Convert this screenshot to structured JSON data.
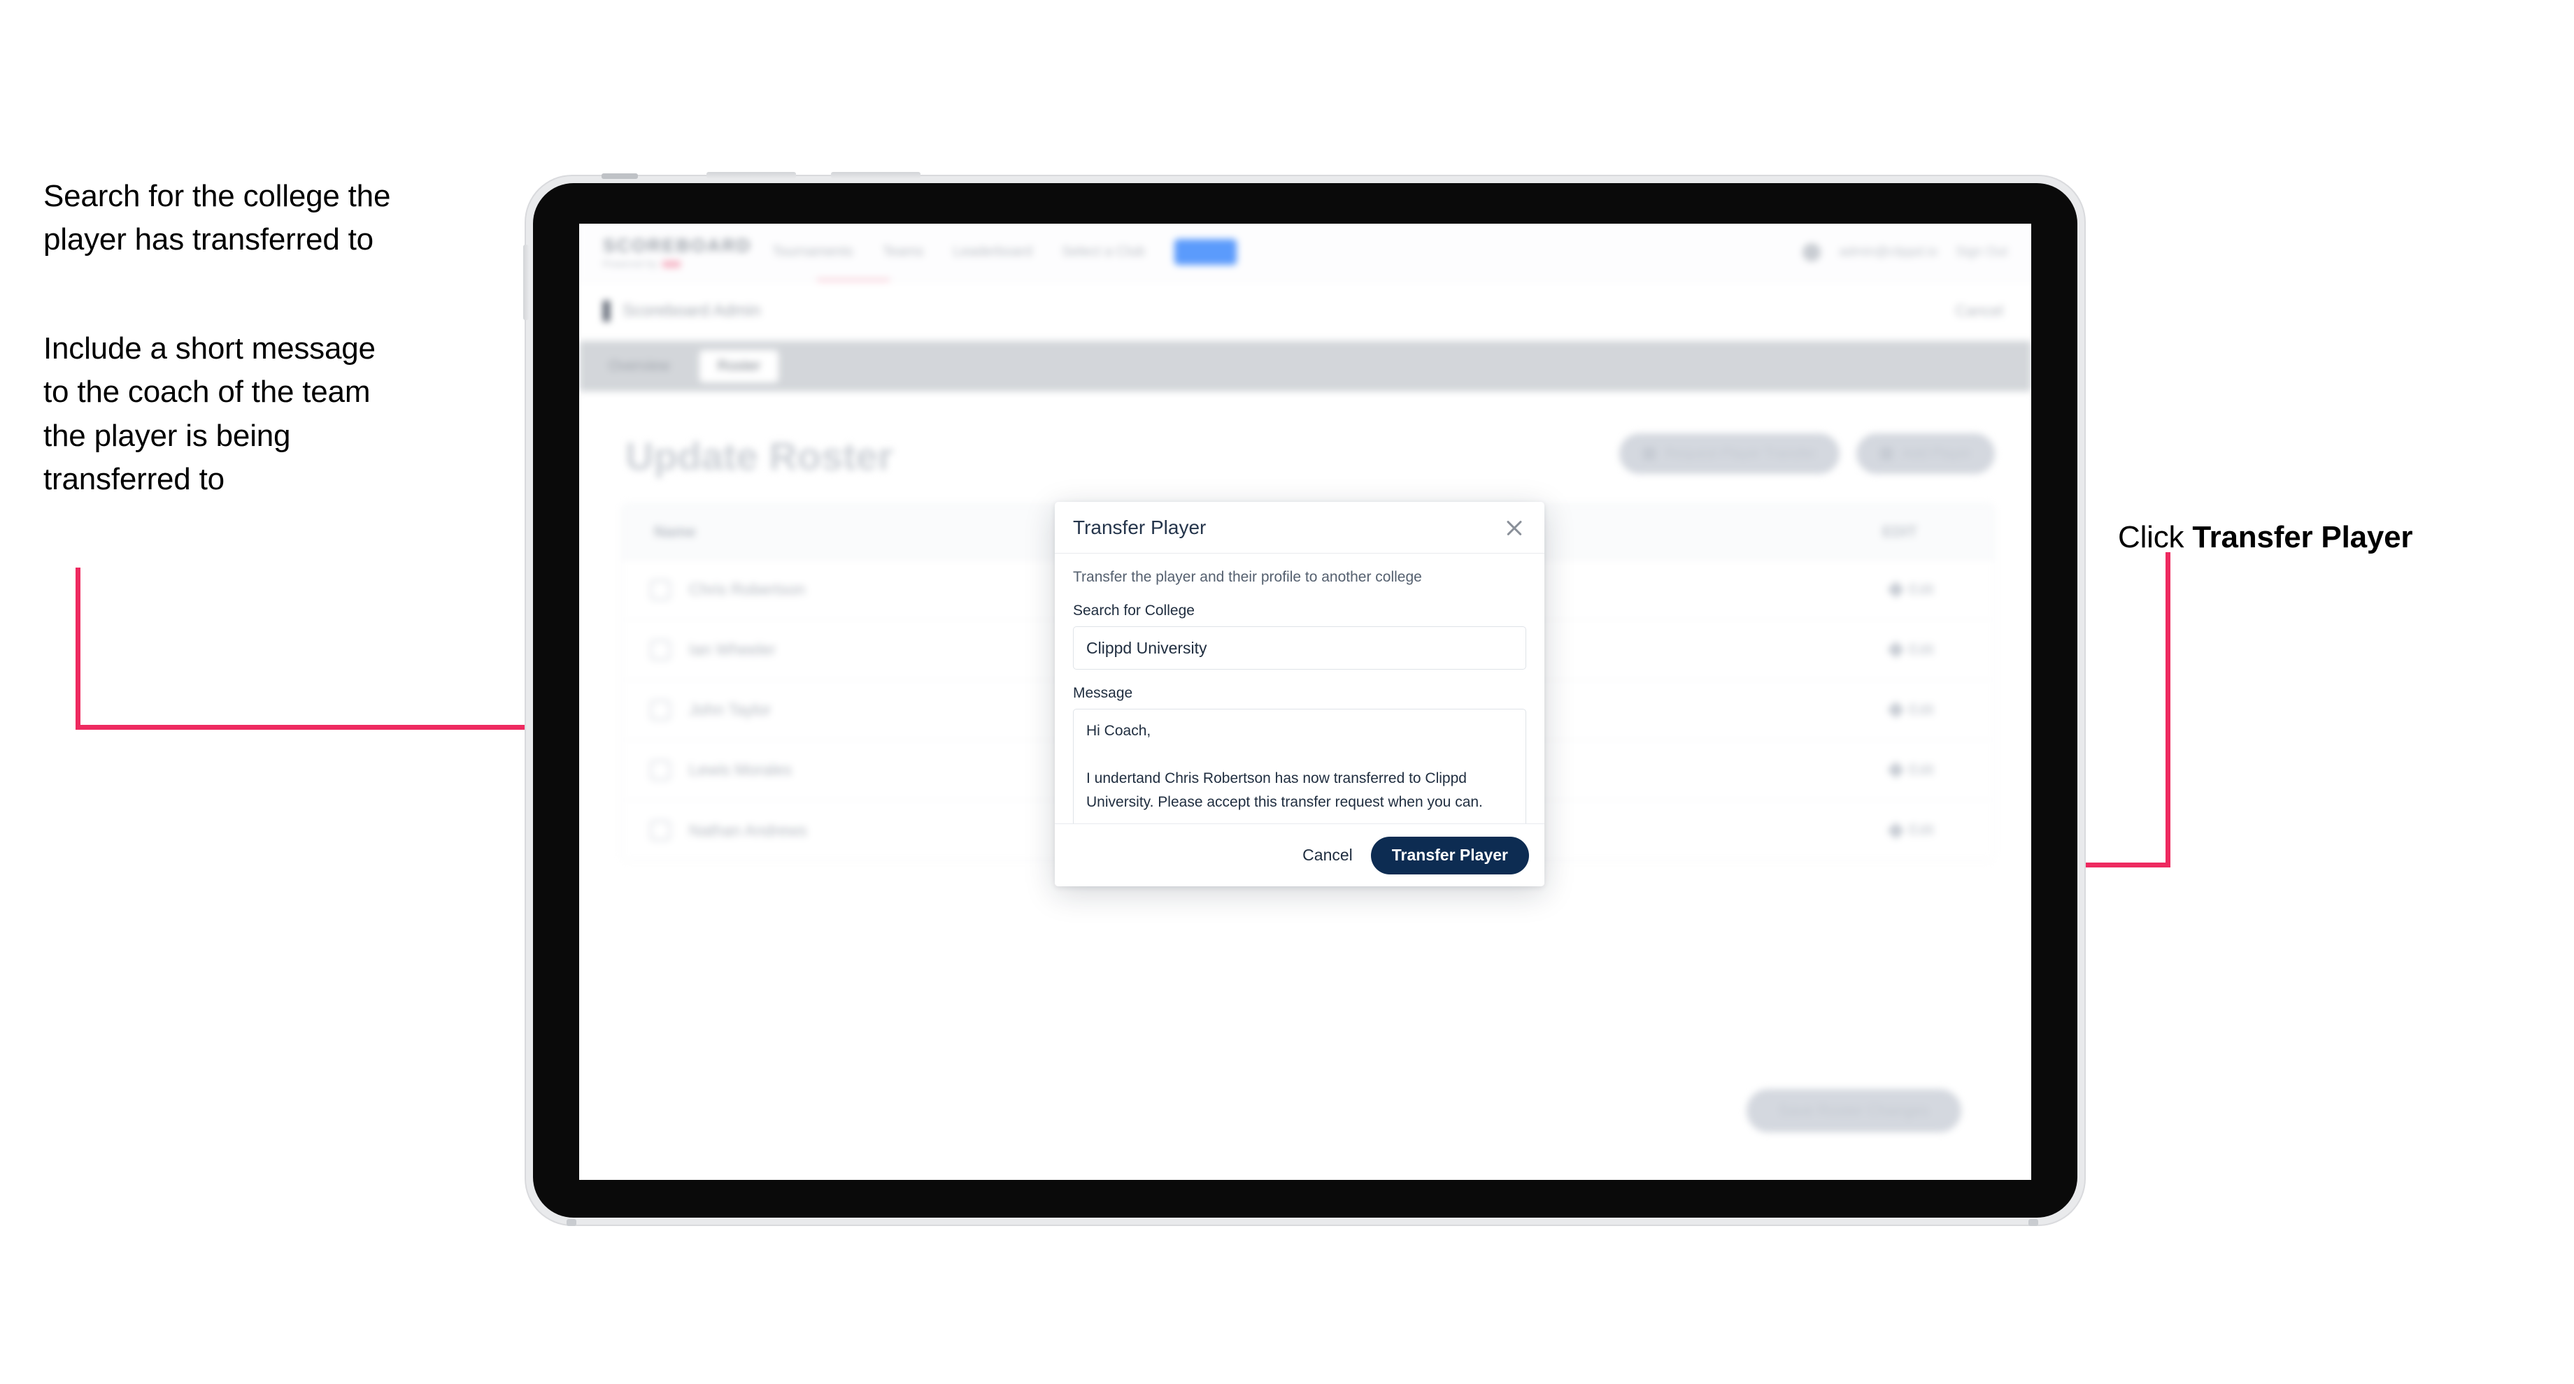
{
  "annotations": {
    "left_1": "Search for the college the\nplayer has transferred to",
    "left_2": "Include a short message\nto the coach of the team\nthe player is being\ntransferred to",
    "right_prefix": "Click ",
    "right_strong": "Transfer Player"
  },
  "colors": {
    "accent_pink": "#ee2a60",
    "primary_navy": "#0d2c52",
    "nav_pill_blue": "#5b9bfc"
  },
  "app": {
    "brand": {
      "name": "SCOREBOARD",
      "sub": "Powered by",
      "sub_badge": ""
    },
    "nav_links": [
      "Tournaments",
      "Teams",
      "Leaderboard",
      "Select a Club"
    ],
    "nav_pill": "Admin",
    "user_email": "admin@clippd.io",
    "sign_out": "Sign Out",
    "breadcrumb": "Scoreboard Admin",
    "breadcrumb_action": "Cancel",
    "tabs": [
      {
        "label": "Overview",
        "active": false
      },
      {
        "label": "Roster",
        "active": true
      }
    ],
    "page_title": "Update Roster",
    "top_actions": [
      {
        "label": "Request Player Transfer",
        "icon": "transfer-icon"
      },
      {
        "label": "Add Player",
        "icon": "plus-icon"
      }
    ],
    "roster": {
      "col_name": "Name",
      "col_edit": "EDIT",
      "rows": [
        {
          "name": "Chris Robertson",
          "edit": "Edit"
        },
        {
          "name": "Ian Wheeler",
          "edit": "Edit"
        },
        {
          "name": "John Taylor",
          "edit": "Edit"
        },
        {
          "name": "Lewis Morales",
          "edit": "Edit"
        },
        {
          "name": "Nathan Andrews",
          "edit": "Edit"
        }
      ]
    },
    "save_button": "Save Roster Changes"
  },
  "modal": {
    "title": "Transfer Player",
    "close_icon": "close-icon",
    "description": "Transfer the player and their profile to another college",
    "college_label": "Search for College",
    "college_value": "Clippd University",
    "college_placeholder": "Search for College",
    "message_label": "Message",
    "message_value": "Hi Coach,\n\nI undertand Chris Robertson has now transferred to Clippd University. Please accept this transfer request when you can.",
    "message_placeholder": "Message",
    "cancel_label": "Cancel",
    "submit_label": "Transfer Player"
  }
}
